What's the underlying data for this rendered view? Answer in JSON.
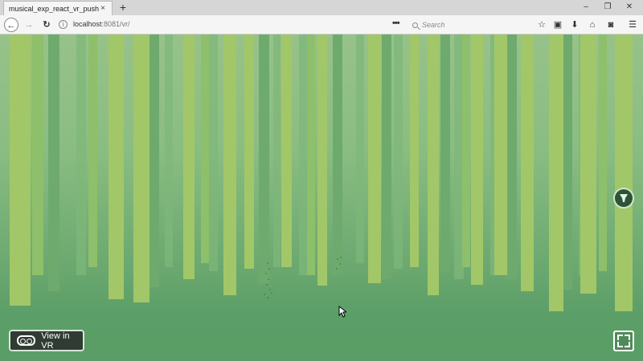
{
  "browser": {
    "tab_title": "musical_exp_react_vr_pusher",
    "tab_close": "×",
    "new_tab": "+",
    "url_host": "localhost",
    "url_rest": ":8081/vr/",
    "search_placeholder": "Search",
    "menu_dots": "•••"
  },
  "window_controls": {
    "minimize": "–",
    "restore": "❐",
    "close": "✕"
  },
  "toolbar_icons": [
    "star-icon",
    "clipboard-icon",
    "download-icon",
    "home-icon",
    "pocket-icon",
    "menu-icon"
  ],
  "scene": {
    "colors": {
      "sky": "#97c289",
      "ground": "#5a9c66",
      "trunk_light": "#a6c96b",
      "trunk_mid": "#8fbe6b",
      "trunk_dark": "#6aa870"
    }
  },
  "vr_button": {
    "label": "View in VR"
  },
  "icons": {
    "fullscreen": "fullscreen-icon",
    "sound": "sound-icon",
    "vr": "vr-goggles-icon"
  }
}
